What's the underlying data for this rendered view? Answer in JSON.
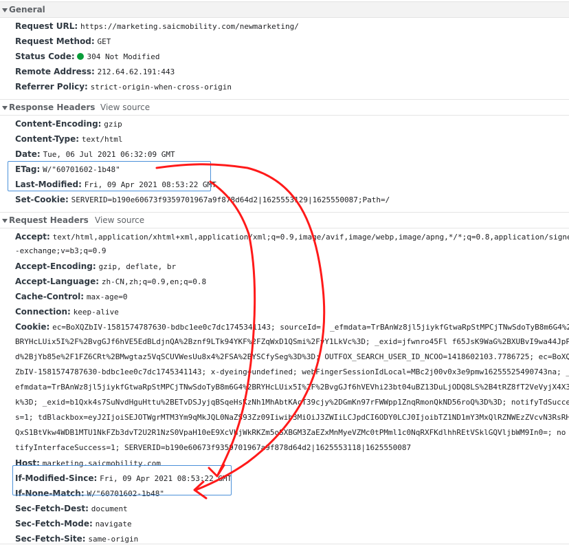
{
  "general": {
    "title": "General",
    "rows": [
      {
        "key": "Request URL:",
        "value": "https://marketing.saicmobility.com/newmarketing/"
      },
      {
        "key": "Request Method:",
        "value": "GET"
      },
      {
        "key": "Status Code:",
        "value": "304 Not Modified"
      },
      {
        "key": "Remote Address:",
        "value": "212.64.62.191:443"
      },
      {
        "key": "Referrer Policy:",
        "value": "strict-origin-when-cross-origin"
      }
    ]
  },
  "response_headers": {
    "title": "Response Headers",
    "view_source": "View source",
    "rows": [
      {
        "key": "Content-Encoding:",
        "value": "gzip"
      },
      {
        "key": "Content-Type:",
        "value": "text/html"
      },
      {
        "key": "Date:",
        "value": "Tue, 06 Jul 2021 06:32:09 GMT"
      },
      {
        "key": "ETag:",
        "value": "W/\"60701602-1b48\""
      },
      {
        "key": "Last-Modified:",
        "value": "Fri, 09 Apr 2021 08:53:22 GMT"
      },
      {
        "key": "Set-Cookie:",
        "value": "SERVERID=b190e60673f9359701967a9f878d64d2|1625553129|1625550087;Path=/"
      }
    ]
  },
  "request_headers": {
    "title": "Request Headers",
    "view_source": "View source",
    "accept": {
      "key": "Accept:",
      "line1": "text/html,application/xhtml+xml,application/xml;q=0.9,image/avif,image/webp,image/apng,*/*;q=0.8,application/signed",
      "line2": "-exchange;v=b3;q=0.9"
    },
    "rows_a": [
      {
        "key": "Accept-Encoding:",
        "value": "gzip, deflate, br"
      },
      {
        "key": "Accept-Language:",
        "value": "zh-CN,zh;q=0.9,en;q=0.8"
      },
      {
        "key": "Cache-Control:",
        "value": "max-age=0"
      },
      {
        "key": "Connection:",
        "value": "keep-alive"
      }
    ],
    "cookie": {
      "key": "Cookie:",
      "line1": "ec=BoXQZbIV-1581574787630-bdbc1ee0c7dc1745341143; sourceId=; _efmdata=TrBAnWz8jl5jiykfGtwaRpStMPCjTNwSdoTyB8m6G4%2",
      "lines": [
        "BRYHcLUix5I%2F%2BvgGJf6hVE5EdBLdjnQA%2Bznf9LTk94YKF%2FZqWxD1QSmi%2FyY1LkVc%3D; _exid=jfwnro45Fl f65JsK9WaG%2BXUBvI9wa44JpP9P",
        "d%2BjYb85e%2F1FZ6CRt%2BMwgtaz5VqSCUVWesUu8x4%2FSA%2BYSCfySeg%3D%3D; OUTFOX_SEARCH_USER_ID_NCOO=1418602103.7786725; ec=BoXQ",
        "ZbIV-1581574787630-bdbc1ee0c7dc1745341143; x-dyeing=undefined; webFingerSessionIdLocal=MBc2j00v0x3e9pmw16255525490743na; _",
        "efmdata=TrBAnWz8jl5jiykfGtwaRpStMPCjTNwSdoTyB8m6G4%2BRYHcLUix5I%2F%2BvgGJf6hVEVhi23bt04uBZ13DuLjODQ8LS%2B4tRZ8fT2VeVyjX4X3",
        "k%3D; _exid=b1Qxk4s7SuNvdHguHttu%2BETvDSJyjqBSqeHsKzNh1MhAbtKAcT39cjy%2DGmKn97rFWWpp1ZnqRmonQkND56roQ%3D%3D; notifyTdSucces",
        "s=1; tdBlackbox=eyJ2IjoiSEJOTWgrMTM3Ym9qMkJQL0NaZS93Zz09Iiwib3MiOiJ3ZWIiLCJpdCI6ODY0LCJ0IjoibTZ1ND1mY3MxQlRZNWEzZVcvN3RsRH",
        "QxS1BtVkw4WDB1MTU1NkFZb3dvT2U2R1NzS0VpaH10eE9XcVhjWkRKZm5oSXBGM3ZaEZxMnMyeVZMc0tPMml1c0NqRXFKdlhhREtVSklGQVljbWM9In0=; no",
        "tifyInterfaceSuccess=1; SERVERID=b190e60673f9359701967a9f878d64d2|1625553118|1625550087"
      ]
    },
    "rows_b": [
      {
        "key": "Host:",
        "value": "marketing.saicmobility.com"
      },
      {
        "key": "If-Modified-Since:",
        "value": "Fri, 09 Apr 2021 08:53:22 GMT"
      },
      {
        "key": "If-None-Match:",
        "value": "W/\"60701602-1b48\""
      },
      {
        "key": "Sec-Fetch-Dest:",
        "value": "document"
      },
      {
        "key": "Sec-Fetch-Mode:",
        "value": "navigate"
      },
      {
        "key": "Sec-Fetch-Site:",
        "value": "same-origin"
      }
    ]
  },
  "colors": {
    "status_ok": "#0a9d3a",
    "annotation_red": "#ff1a1a",
    "highlight_blue": "#4a90d9"
  }
}
